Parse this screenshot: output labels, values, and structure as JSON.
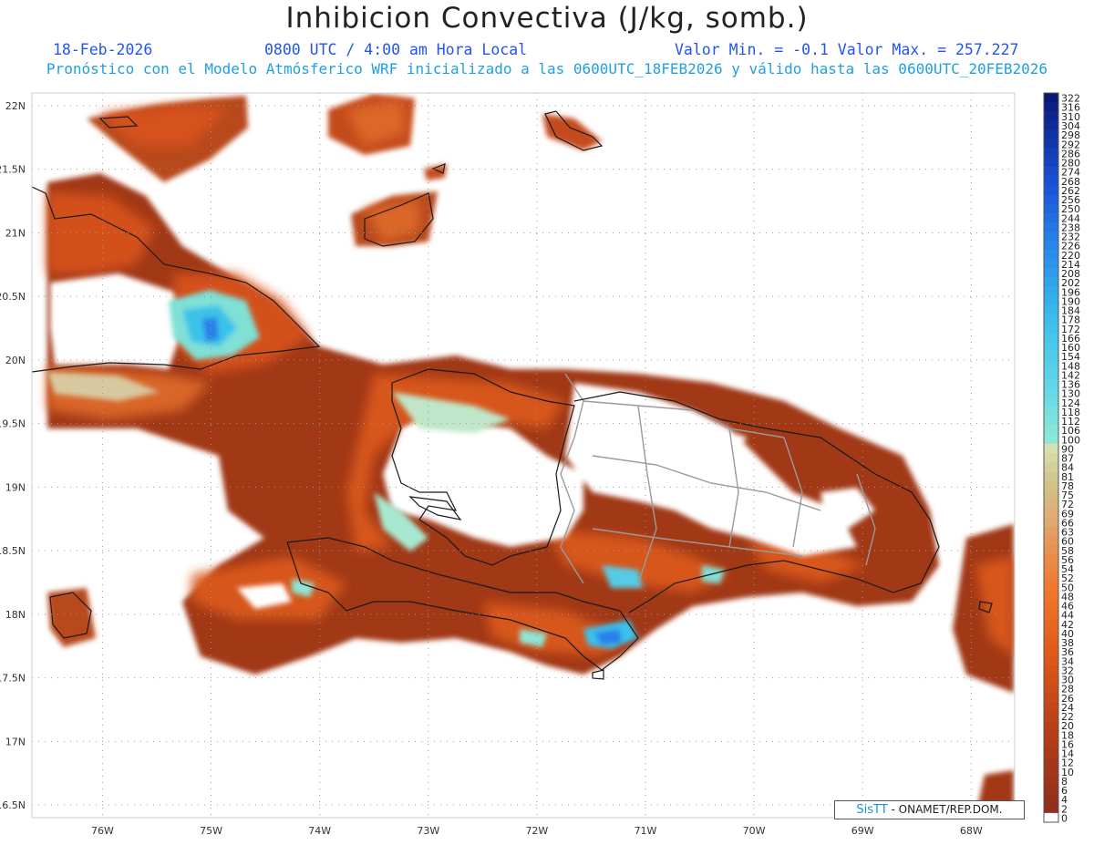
{
  "header": {
    "title": "Inhibicion Convectiva (J/kg, somb.)",
    "date": "18-Feb-2026",
    "time": "0800 UTC / 4:00 am Hora Local",
    "minmax": "Valor Min. = -0.1  Valor Max. = 257.227",
    "subtitle": "Pronóstico con el Modelo Atmósferico WRF inicializado a las 0600UTC_18FEB2026 y válido hasta las  0600UTC_20FEB2026"
  },
  "axes": {
    "lat_labels": [
      "22N",
      "21.5N",
      "21N",
      "20.5N",
      "20N",
      "19.5N",
      "19N",
      "18.5N",
      "18N",
      "17.5N",
      "17N",
      "16.5N"
    ],
    "lat_values": [
      22,
      21.5,
      21,
      20.5,
      20,
      19.5,
      19,
      18.5,
      18,
      17.5,
      17,
      16.5
    ],
    "lon_labels": [
      "76W",
      "75W",
      "74W",
      "73W",
      "72W",
      "71W",
      "70W",
      "69W",
      "68W"
    ],
    "lon_values": [
      -76,
      -75,
      -74,
      -73,
      -72,
      -71,
      -70,
      -69,
      -68
    ],
    "lat_range": [
      16.4,
      22.1
    ],
    "lon_range": [
      -76.65,
      -67.6
    ]
  },
  "legend": {
    "values": [
      "322",
      "316",
      "310",
      "304",
      "298",
      "292",
      "286",
      "280",
      "274",
      "268",
      "262",
      "256",
      "250",
      "244",
      "238",
      "232",
      "226",
      "220",
      "214",
      "208",
      "202",
      "196",
      "190",
      "184",
      "178",
      "172",
      "166",
      "160",
      "154",
      "148",
      "142",
      "136",
      "130",
      "124",
      "118",
      "112",
      "106",
      "100",
      "90",
      "87",
      "84",
      "81",
      "78",
      "75",
      "72",
      "69",
      "66",
      "63",
      "60",
      "58",
      "56",
      "54",
      "52",
      "50",
      "48",
      "46",
      "44",
      "42",
      "40",
      "38",
      "36",
      "34",
      "32",
      "30",
      "28",
      "26",
      "24",
      "22",
      "20",
      "18",
      "16",
      "14",
      "12",
      "10",
      "8",
      "6",
      "4",
      "2",
      "0"
    ]
  },
  "credit": {
    "brand": "SisTT",
    "text": " - ONAMET/REP.DOM."
  },
  "palette": {
    "brown_dark": "#8b2e1f",
    "brown": "#a93a1c",
    "orange_red": "#d6501a",
    "orange": "#ec6a1c",
    "tan": "#e8c08a",
    "aqua": "#8ee8d8",
    "cyan": "#3cc8ea",
    "blue": "#2a7fe8",
    "navy": "#0b1f7a"
  }
}
